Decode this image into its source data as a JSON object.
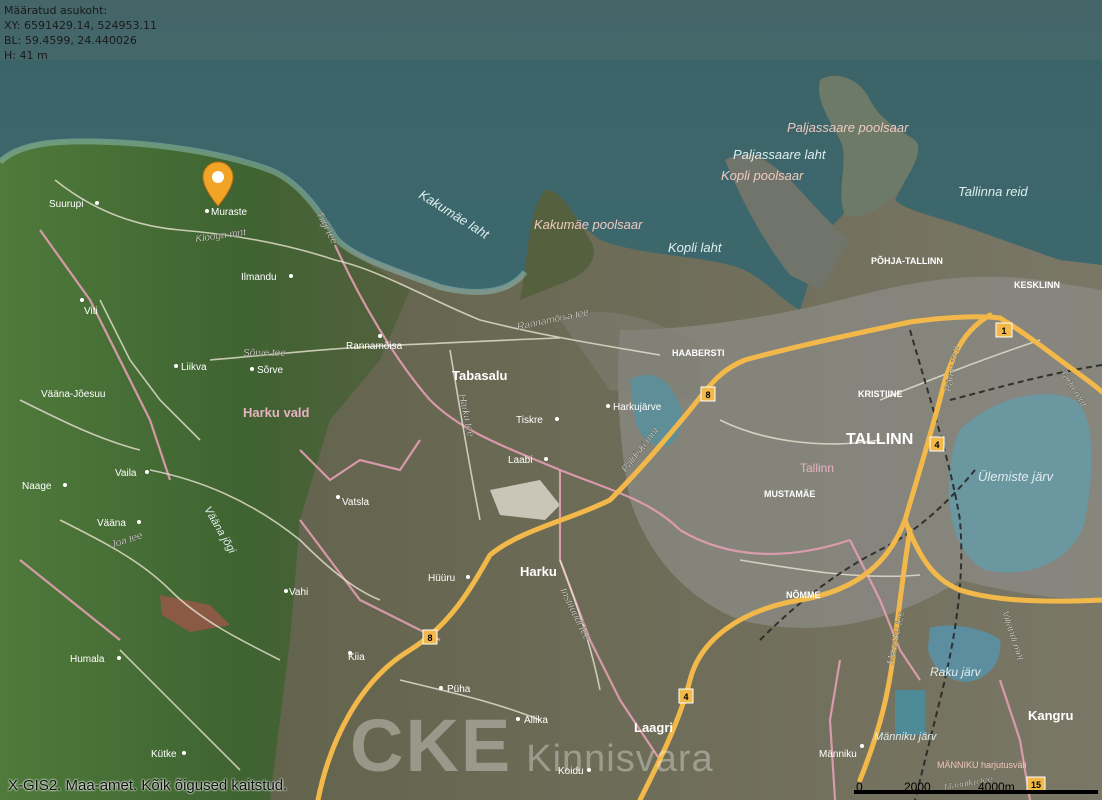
{
  "location_info": {
    "title": "Määratud asukoht:",
    "xy": "XY: 6591429.14, 524953.11",
    "bl": "BL: 59.4599, 24.440026",
    "h": "H: 41 m"
  },
  "copyright": "X-GIS2. Maa-amet. Kõik õigused kaitstud.",
  "watermark": {
    "main": "CKE",
    "sub": "Kinnisvara"
  },
  "scale": {
    "zero": "0",
    "mid": "2000",
    "end": "4000m"
  },
  "road_shields": [
    "1",
    "4",
    "4",
    "8",
    "8",
    "15"
  ],
  "colors": {
    "highway": "#f2b84a",
    "boundary": "#e49fb3",
    "marker": "#f2a427",
    "sea": "#3f6f76",
    "lake": "#5f8f96",
    "land": "#4a6b3a"
  },
  "labels": {
    "muraste": "Muraste",
    "suurupi": "Suurupi",
    "klooga_mnt": "Klooga mnt",
    "tiigi_tee": "Tiigi tee",
    "ilmandu": "Ilmandu",
    "viti": "Viti",
    "rannamoisa": "Rannamõisa",
    "rannamoisa_tee": "Rannamõisa tee",
    "haabersti": "HAABERSTI",
    "sorve_tee": "Sõrve tee",
    "liikva": "Liikva",
    "sorve": "Sõrve",
    "vaana_joesuu": "Vääna-Jõesuu",
    "tabasalu": "Tabasalu",
    "harku_vald": "Harku vald",
    "harkujarve": "Harkujärve",
    "tiskre": "Tiskre",
    "harku_tee": "Harku tee",
    "laabi": "Laabi",
    "vaila": "Vaila",
    "naage": "Naage",
    "vatsla": "Vatsla",
    "vaana": "Vääna",
    "vaana_jogi": "Vääna jõgi",
    "joa_tee": "Joa tee",
    "vahi": "Vahi",
    "harku": "Harku",
    "instituudi_tee": "Instituudi tee",
    "huuru": "Hüüru",
    "kiia": "Kiia",
    "humala": "Humala",
    "puha": "Püha",
    "allika": "Allika",
    "laagri": "Laagri",
    "kutke": "Kütke",
    "koidu": "Koidu",
    "kakumae_laht": "Kakumäe laht",
    "kakumae_poolsaar": "Kakumäe poolsaar",
    "kopli_laht": "Kopli laht",
    "paljassaare_poolsaar": "Paljassaare poolsaar",
    "paljassaare_laht": "Paljassaare laht",
    "kopli_poolsaar": "Kopli poolsaar",
    "tallinna_reid": "Tallinna reid",
    "pohja_tallinn": "PÕHJA-TALLINN",
    "kesklinn": "KESKLINN",
    "kristiine": "KRISTIINE",
    "tallinn_caps": "TALLINN",
    "tallinn": "Tallinn",
    "mustamae": "MUSTAMÄE",
    "ulemiste_jarv": "Ülemiste järv",
    "paldiski_mnt": "Paldiski mnt",
    "parnu_mnt": "Pärnu mnt",
    "tartu_mnt": "Tartu mnt",
    "nomme": "NÕMME",
    "raku_jarv": "Raku järv",
    "viljandi_mnt": "Viljandi mnt",
    "mannikue_tee": "Männiku tee",
    "manniku_jarv": "Männiku järv",
    "manniku": "Männiku",
    "manniku_harjutusvali": "MÄNNIKU harjutusväli",
    "manniku_tee": "Männiku tee",
    "kangru": "Kangru"
  }
}
